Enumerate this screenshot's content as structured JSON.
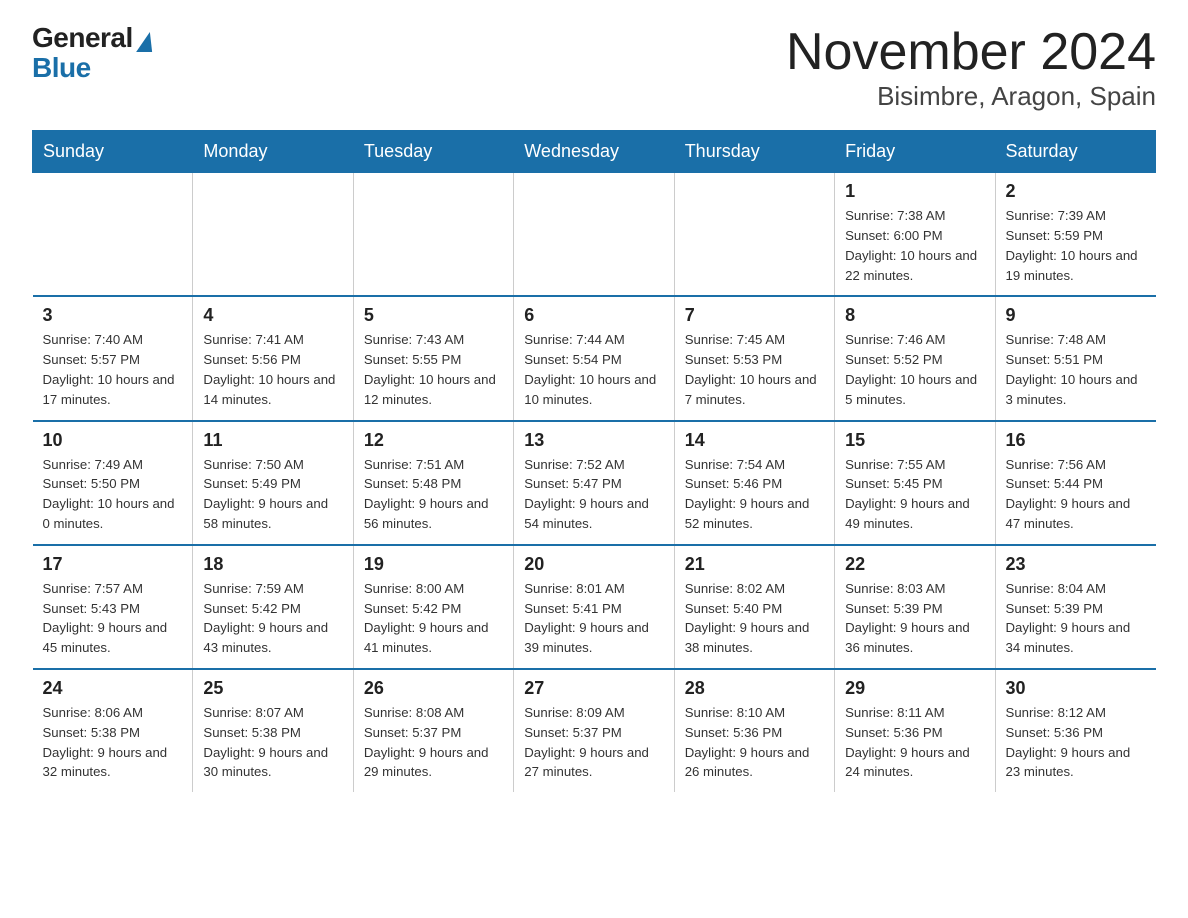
{
  "header": {
    "logo_general": "General",
    "logo_blue": "Blue",
    "month_title": "November 2024",
    "location": "Bisimbre, Aragon, Spain"
  },
  "weekdays": [
    "Sunday",
    "Monday",
    "Tuesday",
    "Wednesday",
    "Thursday",
    "Friday",
    "Saturday"
  ],
  "weeks": [
    [
      {
        "day": "",
        "info": ""
      },
      {
        "day": "",
        "info": ""
      },
      {
        "day": "",
        "info": ""
      },
      {
        "day": "",
        "info": ""
      },
      {
        "day": "",
        "info": ""
      },
      {
        "day": "1",
        "info": "Sunrise: 7:38 AM\nSunset: 6:00 PM\nDaylight: 10 hours\nand 22 minutes."
      },
      {
        "day": "2",
        "info": "Sunrise: 7:39 AM\nSunset: 5:59 PM\nDaylight: 10 hours\nand 19 minutes."
      }
    ],
    [
      {
        "day": "3",
        "info": "Sunrise: 7:40 AM\nSunset: 5:57 PM\nDaylight: 10 hours\nand 17 minutes."
      },
      {
        "day": "4",
        "info": "Sunrise: 7:41 AM\nSunset: 5:56 PM\nDaylight: 10 hours\nand 14 minutes."
      },
      {
        "day": "5",
        "info": "Sunrise: 7:43 AM\nSunset: 5:55 PM\nDaylight: 10 hours\nand 12 minutes."
      },
      {
        "day": "6",
        "info": "Sunrise: 7:44 AM\nSunset: 5:54 PM\nDaylight: 10 hours\nand 10 minutes."
      },
      {
        "day": "7",
        "info": "Sunrise: 7:45 AM\nSunset: 5:53 PM\nDaylight: 10 hours\nand 7 minutes."
      },
      {
        "day": "8",
        "info": "Sunrise: 7:46 AM\nSunset: 5:52 PM\nDaylight: 10 hours\nand 5 minutes."
      },
      {
        "day": "9",
        "info": "Sunrise: 7:48 AM\nSunset: 5:51 PM\nDaylight: 10 hours\nand 3 minutes."
      }
    ],
    [
      {
        "day": "10",
        "info": "Sunrise: 7:49 AM\nSunset: 5:50 PM\nDaylight: 10 hours\nand 0 minutes."
      },
      {
        "day": "11",
        "info": "Sunrise: 7:50 AM\nSunset: 5:49 PM\nDaylight: 9 hours\nand 58 minutes."
      },
      {
        "day": "12",
        "info": "Sunrise: 7:51 AM\nSunset: 5:48 PM\nDaylight: 9 hours\nand 56 minutes."
      },
      {
        "day": "13",
        "info": "Sunrise: 7:52 AM\nSunset: 5:47 PM\nDaylight: 9 hours\nand 54 minutes."
      },
      {
        "day": "14",
        "info": "Sunrise: 7:54 AM\nSunset: 5:46 PM\nDaylight: 9 hours\nand 52 minutes."
      },
      {
        "day": "15",
        "info": "Sunrise: 7:55 AM\nSunset: 5:45 PM\nDaylight: 9 hours\nand 49 minutes."
      },
      {
        "day": "16",
        "info": "Sunrise: 7:56 AM\nSunset: 5:44 PM\nDaylight: 9 hours\nand 47 minutes."
      }
    ],
    [
      {
        "day": "17",
        "info": "Sunrise: 7:57 AM\nSunset: 5:43 PM\nDaylight: 9 hours\nand 45 minutes."
      },
      {
        "day": "18",
        "info": "Sunrise: 7:59 AM\nSunset: 5:42 PM\nDaylight: 9 hours\nand 43 minutes."
      },
      {
        "day": "19",
        "info": "Sunrise: 8:00 AM\nSunset: 5:42 PM\nDaylight: 9 hours\nand 41 minutes."
      },
      {
        "day": "20",
        "info": "Sunrise: 8:01 AM\nSunset: 5:41 PM\nDaylight: 9 hours\nand 39 minutes."
      },
      {
        "day": "21",
        "info": "Sunrise: 8:02 AM\nSunset: 5:40 PM\nDaylight: 9 hours\nand 38 minutes."
      },
      {
        "day": "22",
        "info": "Sunrise: 8:03 AM\nSunset: 5:39 PM\nDaylight: 9 hours\nand 36 minutes."
      },
      {
        "day": "23",
        "info": "Sunrise: 8:04 AM\nSunset: 5:39 PM\nDaylight: 9 hours\nand 34 minutes."
      }
    ],
    [
      {
        "day": "24",
        "info": "Sunrise: 8:06 AM\nSunset: 5:38 PM\nDaylight: 9 hours\nand 32 minutes."
      },
      {
        "day": "25",
        "info": "Sunrise: 8:07 AM\nSunset: 5:38 PM\nDaylight: 9 hours\nand 30 minutes."
      },
      {
        "day": "26",
        "info": "Sunrise: 8:08 AM\nSunset: 5:37 PM\nDaylight: 9 hours\nand 29 minutes."
      },
      {
        "day": "27",
        "info": "Sunrise: 8:09 AM\nSunset: 5:37 PM\nDaylight: 9 hours\nand 27 minutes."
      },
      {
        "day": "28",
        "info": "Sunrise: 8:10 AM\nSunset: 5:36 PM\nDaylight: 9 hours\nand 26 minutes."
      },
      {
        "day": "29",
        "info": "Sunrise: 8:11 AM\nSunset: 5:36 PM\nDaylight: 9 hours\nand 24 minutes."
      },
      {
        "day": "30",
        "info": "Sunrise: 8:12 AM\nSunset: 5:36 PM\nDaylight: 9 hours\nand 23 minutes."
      }
    ]
  ]
}
